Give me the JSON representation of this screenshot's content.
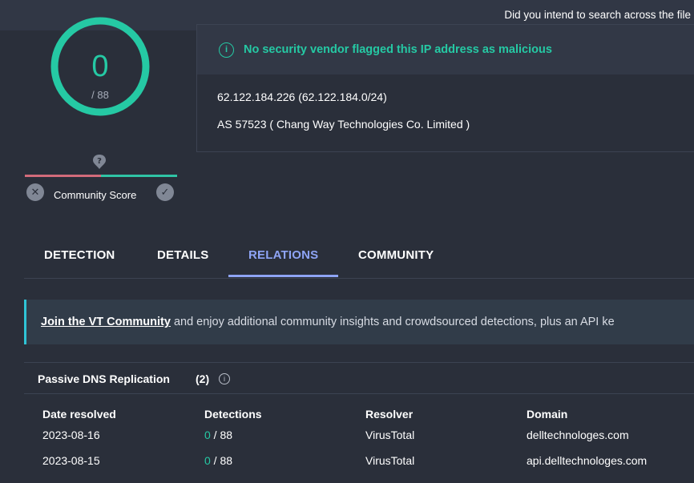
{
  "top_hint": "Did you intend to search across the file",
  "score": {
    "value": "0",
    "total": "/ 88",
    "color": "#25c9a4"
  },
  "community": {
    "label": "Community Score",
    "unknown_icon": "question-icon",
    "downvote_icon": "close-icon",
    "upvote_icon": "check-icon"
  },
  "info_card": {
    "icon": "info-icon",
    "message": "No security vendor flagged this IP address as malicious",
    "ip_line": "62.122.184.226  (62.122.184.0/24)",
    "as_line": "AS 57523  ( Chang Way Technologies Co. Limited )"
  },
  "tabs": [
    {
      "label": "DETECTION",
      "active": false
    },
    {
      "label": "DETAILS",
      "active": false
    },
    {
      "label": "RELATIONS",
      "active": true
    },
    {
      "label": "COMMUNITY",
      "active": false
    }
  ],
  "join_banner": {
    "link_text": "Join the VT Community",
    "rest_text": " and enjoy additional community insights and crowdsourced detections, plus an API ke"
  },
  "passive_dns": {
    "title": "Passive DNS Replication",
    "count": "(2)",
    "columns": [
      "Date resolved",
      "Detections",
      "Resolver",
      "Domain"
    ],
    "rows": [
      {
        "date": "2023-08-16",
        "det_num": "0",
        "det_total": " / 88",
        "resolver": "VirusTotal",
        "domain": "delltechnologes.com"
      },
      {
        "date": "2023-08-15",
        "det_num": "0",
        "det_total": " / 88",
        "resolver": "VirusTotal",
        "domain": "api.delltechnologes.com"
      }
    ]
  }
}
